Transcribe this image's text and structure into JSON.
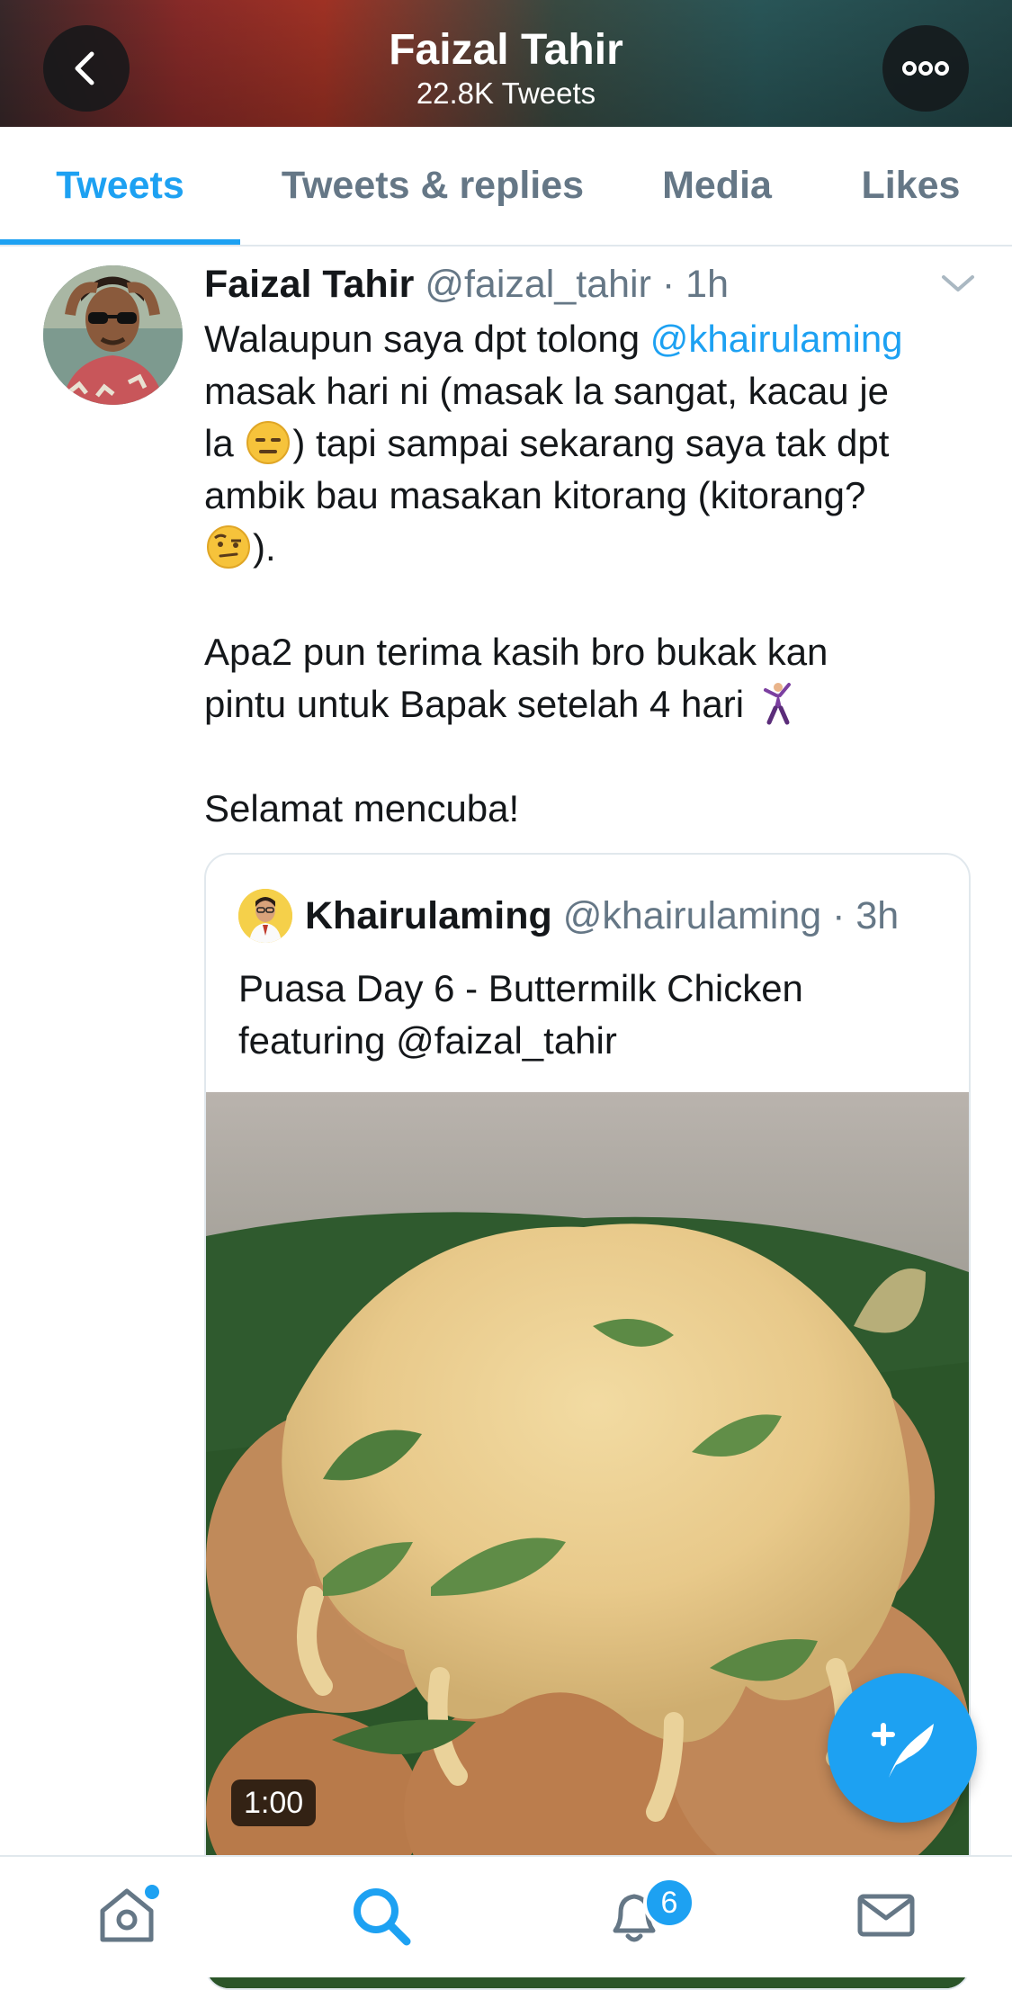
{
  "header": {
    "title": "Faizal Tahir",
    "subtitle": "22.8K Tweets",
    "back_icon": "chevron-left-icon",
    "more_icon": "more-dots-icon"
  },
  "tabs": [
    {
      "label": "Tweets",
      "active": true
    },
    {
      "label": "Tweets & replies",
      "active": false
    },
    {
      "label": "Media",
      "active": false
    },
    {
      "label": "Likes",
      "active": false
    }
  ],
  "tweet": {
    "name": "Faizal Tahir",
    "handle": "@faizal_tahir",
    "separator": "·",
    "time": "1h",
    "line1_text": "Walaupun saya dpt tolong ",
    "line1_mention": "@khairulaming",
    "line2": "masak hari ni (masak la sangat, kacau je",
    "line3_a": "la ",
    "line3_b": ") tapi sampai sekarang saya tak dpt",
    "line4": "ambik bau masakan kitorang (kitorang?",
    "line5_b": ").",
    "line6": "Apa2 pun terima kasih bro bukak kan",
    "line7": "pintu untuk Bapak setelah 4 hari ",
    "line8": "Selamat mencuba!",
    "emojis": [
      "expressionless-face-emoji",
      "raised-eyebrow-face-emoji",
      "dancing-man-emoji"
    ]
  },
  "quote": {
    "name": "Khairulaming",
    "handle": "@khairulaming",
    "separator": "·",
    "time": "3h",
    "text_line1": "Puasa Day 6 - Buttermilk Chicken",
    "text_line2": "featuring @faizal_tahir",
    "video_duration": "1:00"
  },
  "fab": {
    "icon": "compose-tweet-icon"
  },
  "bottom_nav": {
    "items": [
      "home-icon",
      "search-icon",
      "notifications-icon",
      "messages-icon"
    ],
    "notification_count": "6",
    "active": "search"
  },
  "colors": {
    "accent": "#1da1f2",
    "text": "#14171a",
    "muted": "#657786",
    "border": "#e1e8ed"
  }
}
